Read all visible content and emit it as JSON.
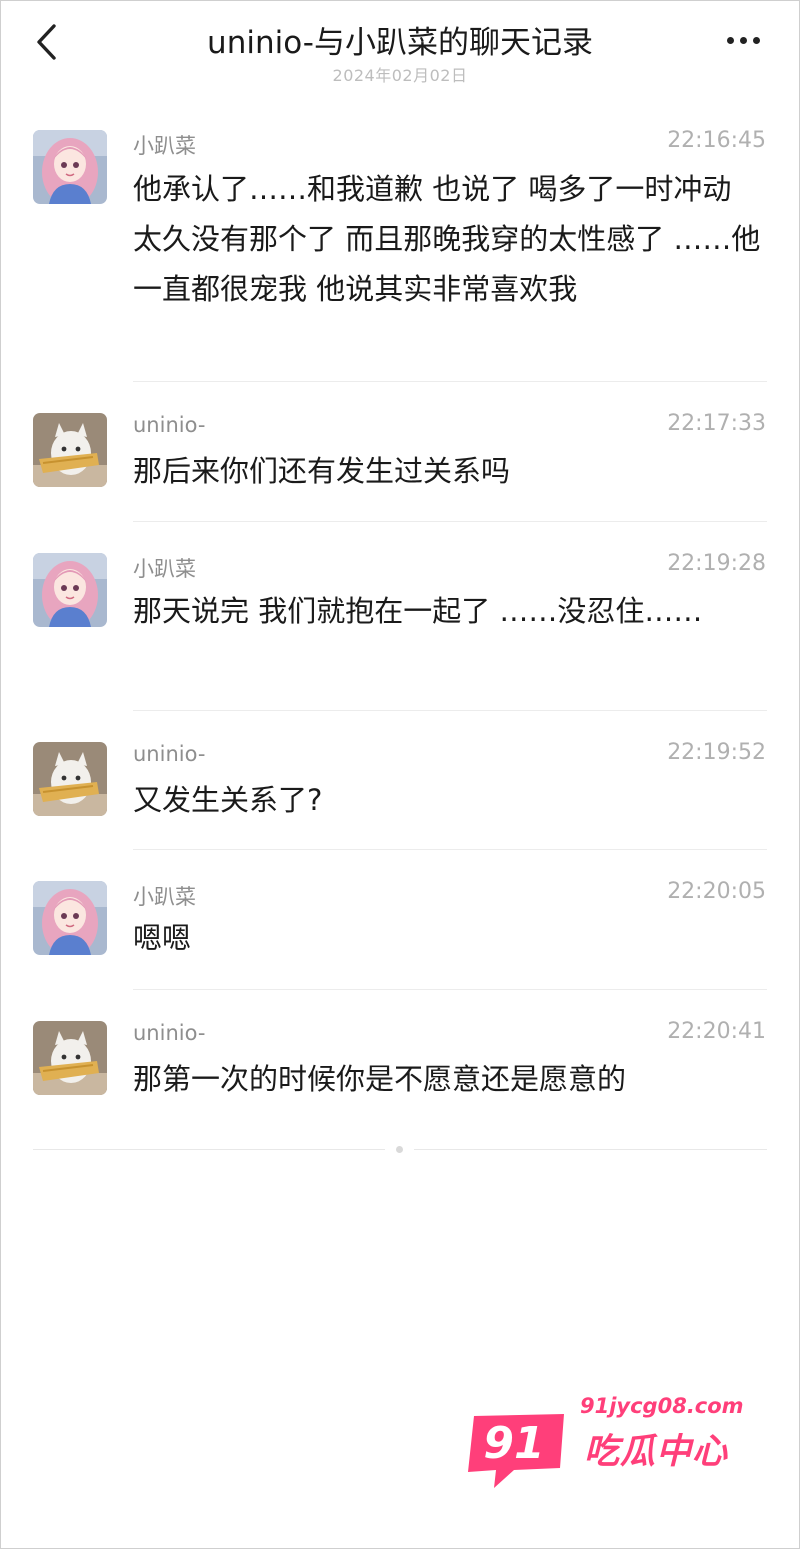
{
  "header": {
    "title": "uninio-与小趴菜的聊天记录",
    "date": "2024年02月02日"
  },
  "messages": [
    {
      "sender": "小趴菜",
      "time": "22:16:45",
      "text": "他承认了……和我道歉 也说了 喝多了一时冲动  太久没有那个了  而且那晚我穿的太性感了 ……他一直都很宠我 他说其实非常喜欢我",
      "avatar": "girl-avatar"
    },
    {
      "sender": "uninio-",
      "time": "22:17:33",
      "text": "那后来你们还有发生过关系吗",
      "avatar": "cat-avatar"
    },
    {
      "sender": "小趴菜",
      "time": "22:19:28",
      "text": "那天说完 我们就抱在一起了 ……没忍住……",
      "avatar": "girl-avatar"
    },
    {
      "sender": "uninio-",
      "time": "22:19:52",
      "text": "又发生关系了?",
      "avatar": "cat-avatar"
    },
    {
      "sender": "小趴菜",
      "time": "22:20:05",
      "text": "嗯嗯",
      "avatar": "girl-avatar"
    },
    {
      "sender": "uninio-",
      "time": "22:20:41",
      "text": "那第一次的时候你是不愿意还是愿意的",
      "avatar": "cat-avatar"
    }
  ],
  "icons": {
    "back": "chevron-left-icon",
    "more": "more-horizontal-icon"
  },
  "watermark": {
    "badge": "91",
    "url": "91jycg08.com",
    "name": "吃瓜中心"
  },
  "colors": {
    "accent": "#ff3f7a",
    "time": "#b0b0b0",
    "sender": "#8e8e8e"
  }
}
